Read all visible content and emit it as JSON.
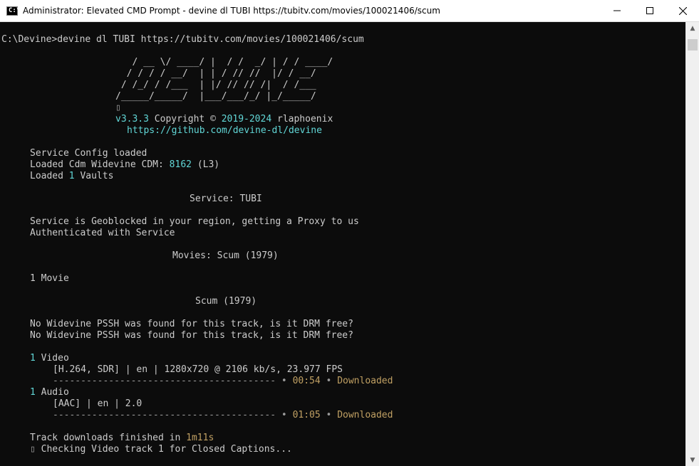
{
  "window": {
    "title": "Administrator: Elevated CMD Prompt - devine  dl TUBI https://tubitv.com/movies/100021406/scum",
    "app_icon": "cmd-icon",
    "controls": {
      "minimize": "minimize-icon",
      "maximize": "maximize-icon",
      "close": "close-icon"
    }
  },
  "console": {
    "prompt": "C:\\Devine>devine dl TUBI https://tubitv.com/movies/100021406/scum",
    "banner": {
      "art": [
        "   / __ \\/ ____/ |  / /  _/ | / / ____/",
        "  / / / / __/  | | / // //  |/ / __/",
        " / /_/ / /___  | |/ // // /|  / /___",
        "/_____/_____/  |___/___/_/ |_/_____/"
      ],
      "glyph": "▯",
      "version": "v3.3.3",
      "copyright_label": "Copyright ©",
      "years": "2019-2024",
      "author": "rlaphoenix",
      "link": "https://github.com/devine-dl/devine"
    },
    "init": {
      "service_config": "Service Config loaded",
      "cdm_prefix": "Loaded Cdm Widevine CDM:",
      "cdm_id": "8162",
      "cdm_level": "(L3)",
      "vaults_prefix": "Loaded",
      "vaults_count": "1",
      "vaults_suffix": "Vaults"
    },
    "service_heading": "Service: TUBI",
    "geoblock": "Service is Geoblocked in your region, getting a Proxy to us",
    "authenticated": "Authenticated with Service",
    "movies_heading": "Movies: Scum (1979)",
    "movie_count": "1 Movie",
    "title_heading": "Scum (1979)",
    "pssh_warnings": [
      "No Widevine PSSH was found for this track, is it DRM free?",
      "No Widevine PSSH was found for this track, is it DRM free?"
    ],
    "tracks": [
      {
        "count": "1",
        "kind": "Video",
        "detail": "[H.264, SDR] | en | 1280x720 @ 2106 kb/s, 23.977 FPS",
        "progress_bar": "----------------------------------------",
        "bullet": "•",
        "time": "00:54",
        "status": "Downloaded",
        "progress": 1.0
      },
      {
        "count": "1",
        "kind": "Audio",
        "detail": "[AAC] | en | 2.0",
        "progress_bar": "----------------------------------------",
        "bullet": "•",
        "time": "01:05",
        "status": "Downloaded",
        "progress": 1.0
      }
    ],
    "finished_prefix": "Track downloads finished in",
    "finished_time": "1m11s",
    "captions_glyph": "▯",
    "captions_text": "Checking Video track 1 for Closed Captions..."
  },
  "scrollbar": {
    "up_icon": "▲",
    "down_icon": "▼"
  },
  "colors": {
    "background": "#0c0c0c",
    "text": "#cccccc",
    "cyan": "#61d6d6",
    "gold": "#c0a063"
  }
}
